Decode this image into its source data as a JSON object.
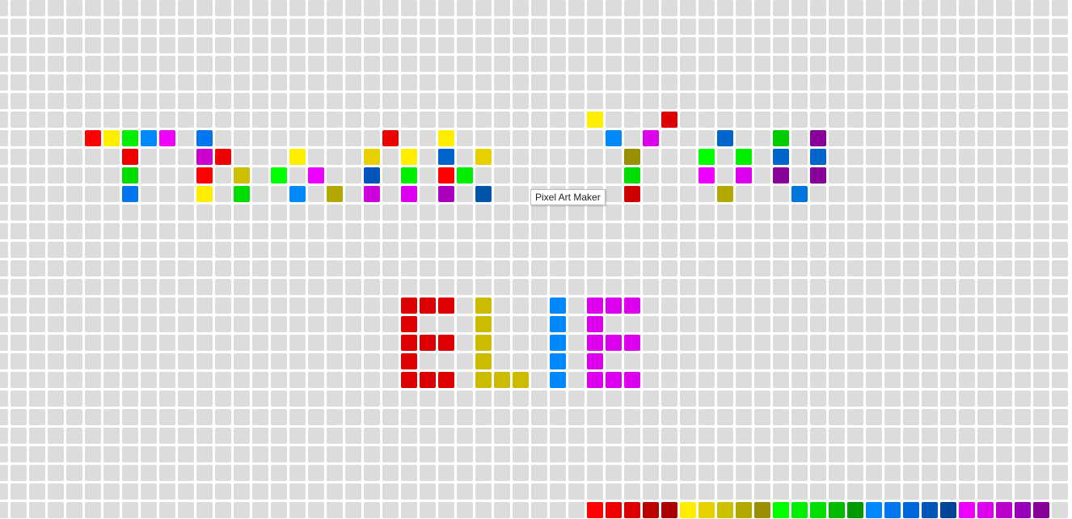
{
  "app": {
    "tooltip": "Pixel Art Maker"
  },
  "grid": {
    "background_color": "#dcdcdc",
    "divider_color": "#ffffff"
  },
  "palette": {
    "colors": [
      "#ff0000",
      "#ee0000",
      "#dd0000",
      "#bb0000",
      "#aa0000",
      "#ffee00",
      "#e6d000",
      "#ccc000",
      "#b3a800",
      "#998f00",
      "#00ff00",
      "#00ee00",
      "#00dd00",
      "#00bb00",
      "#009900",
      "#0088ff",
      "#0077ee",
      "#0066dd",
      "#0055bb",
      "#004499",
      "#ee00ff",
      "#dd00ee",
      "#bb00cc",
      "#9900bb",
      "#880099"
    ]
  },
  "painted_cells": [
    {
      "col": 4,
      "row": 7,
      "color": "#ff0000"
    },
    {
      "col": 5,
      "row": 7,
      "color": "#ffee00"
    },
    {
      "col": 6,
      "row": 7,
      "color": "#00ee00"
    },
    {
      "col": 7,
      "row": 7,
      "color": "#0088ff"
    },
    {
      "col": 8,
      "row": 7,
      "color": "#ee00ff"
    },
    {
      "col": 6,
      "row": 8,
      "color": "#ee0000"
    },
    {
      "col": 6,
      "row": 9,
      "color": "#00dd00"
    },
    {
      "col": 6,
      "row": 10,
      "color": "#0077ee"
    },
    {
      "col": 10,
      "row": 7,
      "color": "#0077ee"
    },
    {
      "col": 10,
      "row": 8,
      "color": "#cc00cc"
    },
    {
      "col": 11,
      "row": 8,
      "color": "#ee0000"
    },
    {
      "col": 10,
      "row": 9,
      "color": "#ff0000"
    },
    {
      "col": 12,
      "row": 9,
      "color": "#ccc000"
    },
    {
      "col": 10,
      "row": 10,
      "color": "#ffee00"
    },
    {
      "col": 12,
      "row": 10,
      "color": "#00dd00"
    },
    {
      "col": 15,
      "row": 8,
      "color": "#ffee00"
    },
    {
      "col": 14,
      "row": 9,
      "color": "#00ff00"
    },
    {
      "col": 16,
      "row": 9,
      "color": "#ee00ff"
    },
    {
      "col": 15,
      "row": 10,
      "color": "#0088ff"
    },
    {
      "col": 17,
      "row": 10,
      "color": "#b3a800"
    },
    {
      "col": 20,
      "row": 7,
      "color": "#ee0000"
    },
    {
      "col": 19,
      "row": 8,
      "color": "#e6d000"
    },
    {
      "col": 21,
      "row": 8,
      "color": "#ffee00"
    },
    {
      "col": 19,
      "row": 9,
      "color": "#0055bb"
    },
    {
      "col": 21,
      "row": 9,
      "color": "#00ee00"
    },
    {
      "col": 19,
      "row": 10,
      "color": "#cc00dd"
    },
    {
      "col": 21,
      "row": 10,
      "color": "#dd00ee"
    },
    {
      "col": 23,
      "row": 7,
      "color": "#ffee00"
    },
    {
      "col": 23,
      "row": 8,
      "color": "#0066cc"
    },
    {
      "col": 25,
      "row": 8,
      "color": "#e6d000"
    },
    {
      "col": 23,
      "row": 9,
      "color": "#ff0000"
    },
    {
      "col": 24,
      "row": 9,
      "color": "#00ee00"
    },
    {
      "col": 23,
      "row": 10,
      "color": "#aa00bb"
    },
    {
      "col": 25,
      "row": 10,
      "color": "#0055aa"
    },
    {
      "col": 31,
      "row": 6,
      "color": "#ffee00"
    },
    {
      "col": 35,
      "row": 6,
      "color": "#dd0000"
    },
    {
      "col": 32,
      "row": 7,
      "color": "#0088ff"
    },
    {
      "col": 34,
      "row": 7,
      "color": "#dd00ee"
    },
    {
      "col": 33,
      "row": 8,
      "color": "#998f00"
    },
    {
      "col": 33,
      "row": 9,
      "color": "#00dd00"
    },
    {
      "col": 33,
      "row": 10,
      "color": "#cc0000"
    },
    {
      "col": 38,
      "row": 7,
      "color": "#0066cc"
    },
    {
      "col": 37,
      "row": 8,
      "color": "#00ff00"
    },
    {
      "col": 39,
      "row": 8,
      "color": "#00ee00"
    },
    {
      "col": 37,
      "row": 9,
      "color": "#ee00ff"
    },
    {
      "col": 39,
      "row": 9,
      "color": "#dd00ee"
    },
    {
      "col": 38,
      "row": 10,
      "color": "#b3a800"
    },
    {
      "col": 41,
      "row": 7,
      "color": "#00cc00"
    },
    {
      "col": 43,
      "row": 7,
      "color": "#880099"
    },
    {
      "col": 41,
      "row": 8,
      "color": "#0066cc"
    },
    {
      "col": 43,
      "row": 8,
      "color": "#0066cc"
    },
    {
      "col": 41,
      "row": 9,
      "color": "#880099"
    },
    {
      "col": 43,
      "row": 9,
      "color": "#880099"
    },
    {
      "col": 42,
      "row": 10,
      "color": "#0077dd"
    },
    {
      "col": 21,
      "row": 16,
      "color": "#dd0000"
    },
    {
      "col": 22,
      "row": 16,
      "color": "#dd0000"
    },
    {
      "col": 23,
      "row": 16,
      "color": "#dd0000"
    },
    {
      "col": 21,
      "row": 17,
      "color": "#dd0000"
    },
    {
      "col": 21,
      "row": 18,
      "color": "#dd0000"
    },
    {
      "col": 22,
      "row": 18,
      "color": "#dd0000"
    },
    {
      "col": 23,
      "row": 18,
      "color": "#dd0000"
    },
    {
      "col": 21,
      "row": 19,
      "color": "#dd0000"
    },
    {
      "col": 21,
      "row": 20,
      "color": "#dd0000"
    },
    {
      "col": 22,
      "row": 20,
      "color": "#dd0000"
    },
    {
      "col": 23,
      "row": 20,
      "color": "#dd0000"
    },
    {
      "col": 25,
      "row": 16,
      "color": "#ccbb00"
    },
    {
      "col": 25,
      "row": 17,
      "color": "#ccbb00"
    },
    {
      "col": 25,
      "row": 18,
      "color": "#ccbb00"
    },
    {
      "col": 25,
      "row": 19,
      "color": "#ccbb00"
    },
    {
      "col": 25,
      "row": 20,
      "color": "#ccbb00"
    },
    {
      "col": 26,
      "row": 20,
      "color": "#ccbb00"
    },
    {
      "col": 27,
      "row": 20,
      "color": "#ccbb00"
    },
    {
      "col": 29,
      "row": 16,
      "color": "#0088ff"
    },
    {
      "col": 29,
      "row": 17,
      "color": "#0088ff"
    },
    {
      "col": 29,
      "row": 18,
      "color": "#0088ff"
    },
    {
      "col": 29,
      "row": 19,
      "color": "#0088ff"
    },
    {
      "col": 29,
      "row": 20,
      "color": "#0088ff"
    },
    {
      "col": 31,
      "row": 16,
      "color": "#dd00ee"
    },
    {
      "col": 32,
      "row": 16,
      "color": "#dd00ee"
    },
    {
      "col": 33,
      "row": 16,
      "color": "#dd00ee"
    },
    {
      "col": 31,
      "row": 17,
      "color": "#dd00ee"
    },
    {
      "col": 31,
      "row": 18,
      "color": "#dd00ee"
    },
    {
      "col": 32,
      "row": 18,
      "color": "#dd00ee"
    },
    {
      "col": 33,
      "row": 18,
      "color": "#dd00ee"
    },
    {
      "col": 31,
      "row": 19,
      "color": "#dd00ee"
    },
    {
      "col": 31,
      "row": 20,
      "color": "#dd00ee"
    },
    {
      "col": 32,
      "row": 20,
      "color": "#dd00ee"
    },
    {
      "col": 33,
      "row": 20,
      "color": "#dd00ee"
    }
  ]
}
